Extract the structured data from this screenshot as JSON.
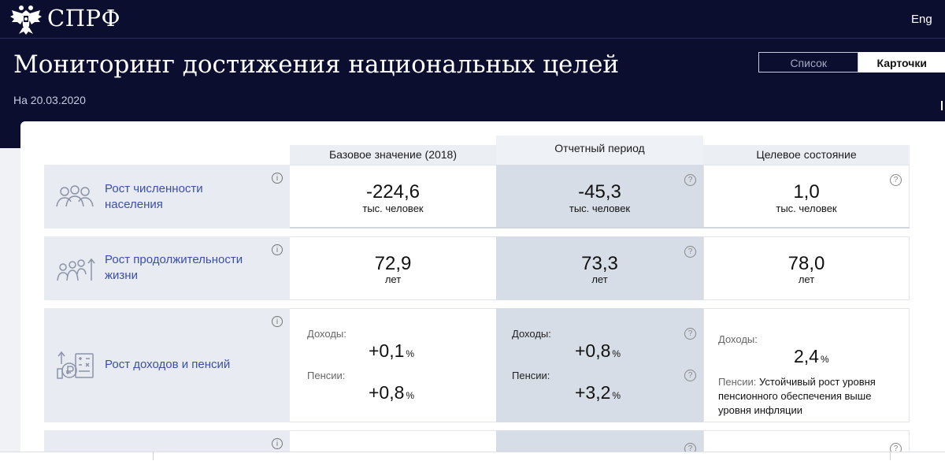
{
  "app": {
    "logo_text": "СПРФ",
    "lang_label": "Eng"
  },
  "page": {
    "title": "Мониторинг достижения национальных целей",
    "date": "На 20.03.2020"
  },
  "view_toggle": {
    "list_label": "Список",
    "cards_label": "Карточки",
    "active": "Карточки"
  },
  "columns": {
    "base": "Базовое значение (2018)",
    "report": "Отчетный период",
    "target": "Целевое состояние"
  },
  "rows": [
    {
      "title_line1": "Рост численности",
      "title_line2": "населения",
      "icon": "people-group-icon",
      "base": {
        "value": "-224,6",
        "unit": "тыс. человек"
      },
      "report": {
        "value": "-45,3",
        "unit": "тыс. человек"
      },
      "target": {
        "value": "1,0",
        "unit": "тыс. человек"
      }
    },
    {
      "title_line1": "Рост продолжительности",
      "title_line2": "жизни",
      "icon": "people-growth-icon",
      "base": {
        "value": "72,9",
        "unit": "лет"
      },
      "report": {
        "value": "73,3",
        "unit": "лет"
      },
      "target": {
        "value": "78,0",
        "unit": "лет"
      }
    },
    {
      "title": "Рост доходов и пенсий",
      "icon": "income-pension-icon",
      "base": {
        "income_label": "Доходы:",
        "income": "+0,1",
        "pension_label": "Пенсии:",
        "pension": "+0,8",
        "unit": "%"
      },
      "report": {
        "income_label": "Доходы:",
        "income": "+0,8",
        "pension_label": "Пенсии:",
        "pension": "+3,2",
        "unit": "%"
      },
      "target": {
        "income_label": "Доходы:",
        "income": "2,4",
        "unit": "%",
        "pension_label": "Пенсии:",
        "pension_text": "Устойчивый рост уровня пенсионного обеспечения выше уровня инфляции"
      }
    }
  ],
  "icons": {
    "info": "i",
    "help": "?"
  }
}
